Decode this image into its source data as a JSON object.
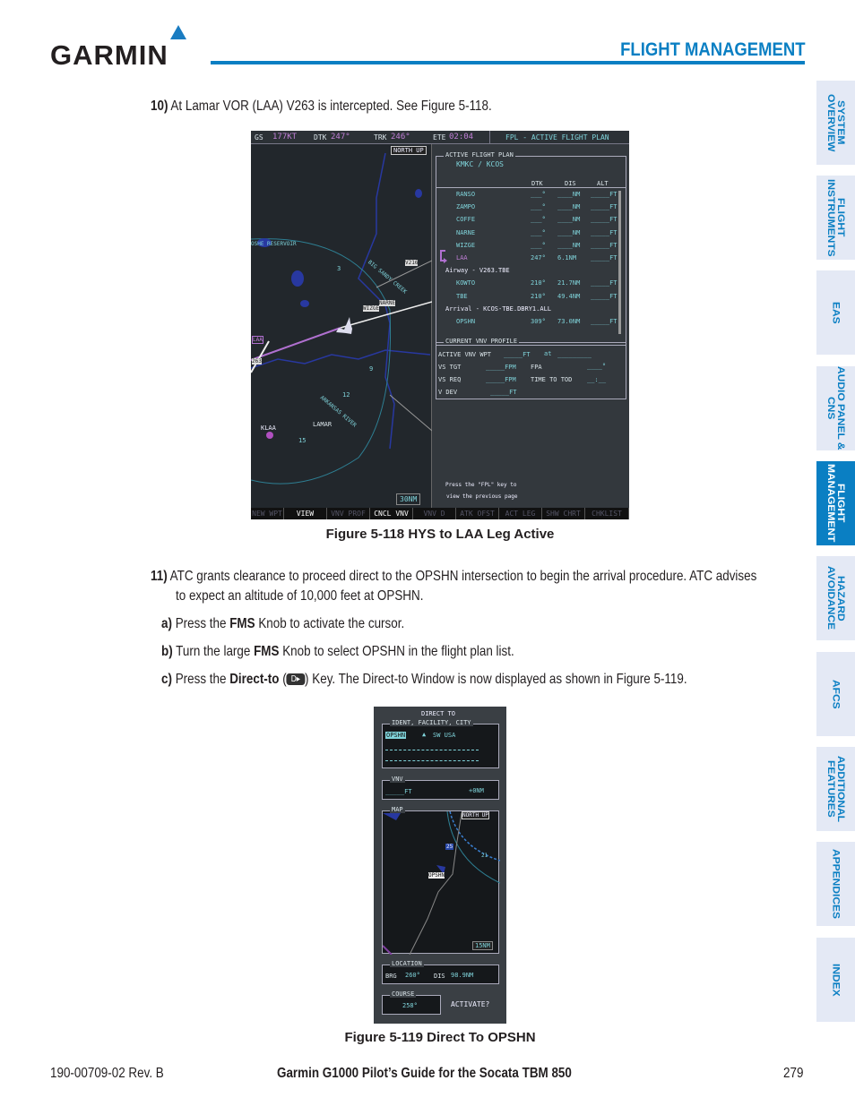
{
  "header": {
    "logo": "GARMIN",
    "section_title": "FLIGHT MANAGEMENT"
  },
  "side_tabs": [
    {
      "label": "SYSTEM OVERVIEW",
      "active": false
    },
    {
      "label": "FLIGHT INSTRUMENTS",
      "active": false
    },
    {
      "label": "EAS",
      "active": false
    },
    {
      "label": "AUDIO PANEL & CNS",
      "active": false
    },
    {
      "label": "FLIGHT MANAGEMENT",
      "active": true
    },
    {
      "label": "HAZARD AVOIDANCE",
      "active": false
    },
    {
      "label": "AFCS",
      "active": false
    },
    {
      "label": "ADDITIONAL FEATURES",
      "active": false
    },
    {
      "label": "APPENDICES",
      "active": false
    },
    {
      "label": "INDEX",
      "active": false
    }
  ],
  "step10": {
    "num": "10)",
    "text": "At Lamar VOR (LAA) V263 is intercepted.  See Figure 5-118."
  },
  "fig118": {
    "caption": "Figure 5-118 HYS to LAA Leg Active",
    "topbar": {
      "gs_l": "GS",
      "gs": "177KT",
      "dtk_l": "DTK",
      "dtk": "247°",
      "trk_l": "TRK",
      "trk": "246°",
      "ete_l": "ETE",
      "ete": "02:04",
      "page": "FPL - ACTIVE FLIGHT PLAN"
    },
    "map": {
      "orientation": "NORTH UP",
      "range": "30NM",
      "labels": {
        "reservoir": "OSHE RESERVOIR",
        "creek": "BIG SANDY CREEK",
        "river": "ARKANSAS RIVER",
        "v216": "V216",
        "narne": "NARNE",
        "wizge": "WIZGE",
        "laa": "LAA",
        "v263": "263",
        "klaa": "KLAA",
        "lamar": "LAMAR",
        "r3": "3",
        "r9": "9",
        "r12": "12",
        "r15": "15"
      }
    },
    "fpl": {
      "box_title": "ACTIVE FLIGHT PLAN",
      "route": "KMKC / KCOS",
      "cols": [
        "DTK",
        "DIS",
        "ALT"
      ],
      "rows": [
        {
          "type": "wpt",
          "name": "RANSO",
          "dtk": "___°",
          "dis": "____NM",
          "alt": "_____FT"
        },
        {
          "type": "wpt",
          "name": "ZAMPO",
          "dtk": "___°",
          "dis": "____NM",
          "alt": "_____FT"
        },
        {
          "type": "wpt",
          "name": "COFFE",
          "dtk": "___°",
          "dis": "____NM",
          "alt": "_____FT"
        },
        {
          "type": "wpt",
          "name": "NARNE",
          "dtk": "___°",
          "dis": "____NM",
          "alt": "_____FT"
        },
        {
          "type": "wpt",
          "name": "WIZGE",
          "dtk": "___°",
          "dis": "____NM",
          "alt": "_____FT"
        },
        {
          "type": "wpt",
          "name": "LAA",
          "dtk": "247°",
          "dis": "6.1NM",
          "alt": "_____FT"
        },
        {
          "type": "hdr",
          "name": "Airway - V263.TBE"
        },
        {
          "type": "wpt",
          "name": "KOWTO",
          "dtk": "210°",
          "dis": "21.7NM",
          "alt": "_____FT"
        },
        {
          "type": "wpt",
          "name": "TBE",
          "dtk": "210°",
          "dis": "49.4NM",
          "alt": "_____FT"
        },
        {
          "type": "hdr",
          "name": "Arrival - KCOS-TBE.DBRY1.ALL"
        },
        {
          "type": "wpt",
          "name": "OPSHN",
          "dtk": "309°",
          "dis": "73.0NM",
          "alt": "_____FT"
        }
      ],
      "vnv": {
        "title": "CURRENT VNV PROFILE",
        "active_l": "ACTIVE VNV WPT",
        "active": "_____FT",
        "at": "at",
        "at_v": "_________",
        "vstgt_l": "VS TGT",
        "vstgt": "_____FPM",
        "fpa_l": "FPA",
        "fpa": "____°",
        "vsreq_l": "VS REQ",
        "vsreq": "_____FPM",
        "tod_l": "TIME TO TOD",
        "tod": "__:__",
        "vdev_l": "V DEV",
        "vdev": "_____FT"
      },
      "msg1": "Press the \"FPL\" key to",
      "msg2": "view the previous page"
    },
    "softkeys": [
      {
        "label": "NEW WPT",
        "on": false
      },
      {
        "label": "VIEW",
        "on": true
      },
      {
        "label": "VNV PROF",
        "on": false
      },
      {
        "label": "CNCL VNV",
        "on": true
      },
      {
        "label": "VNV D",
        "on": false
      },
      {
        "label": "ATK OFST",
        "on": false
      },
      {
        "label": "ACT LEG",
        "on": false
      },
      {
        "label": "SHW CHRT",
        "on": false
      },
      {
        "label": "CHKLIST",
        "on": false
      }
    ]
  },
  "step11": {
    "num": "11)",
    "line1": "ATC grants clearance to proceed direct to the OPSHN intersection to begin the arrival procedure.  ATC advises",
    "line2": "to expect an altitude of 10,000 feet at  OPSHN."
  },
  "substeps": {
    "a": {
      "label": "a)",
      "pre": "Press the ",
      "bold": "FMS",
      "post": " Knob to activate the cursor."
    },
    "b": {
      "label": "b)",
      "pre": "Turn the large ",
      "bold": "FMS",
      "post": " Knob to select OPSHN in the flight plan list."
    },
    "c": {
      "label": "c)",
      "pre": "Press the ",
      "bold": "Direct-to",
      "key": "D▸",
      "post": " Key.  The Direct-to Window is now displayed as shown in Figure 5-119."
    }
  },
  "fig119": {
    "caption": "Figure 5-119 Direct To OPSHN",
    "title": "DIRECT TO",
    "ident_box": "IDENT, FACILITY, CITY",
    "ident": "OPSHN",
    "region": "SW USA",
    "vnv_box": "VNV",
    "vnv_alt": "_____FT",
    "vnv_offset": "+0NM",
    "map_box": "MAP",
    "map_orient": "NORTH UP",
    "map_range": "15NM",
    "map_wpt": "OPSHN",
    "map_shield": "25",
    "map_r21": "21",
    "loc_box": "LOCATION",
    "brg_l": "BRG",
    "brg": "260°",
    "dis_l": "DIS",
    "dis": "98.9NM",
    "course_box": "COURSE",
    "course": "258°",
    "activate": "ACTIVATE?"
  },
  "footer": {
    "doc": "190-00709-02  Rev. B",
    "title": "Garmin G1000 Pilot’s Guide for the Socata TBM 850",
    "page": "279"
  }
}
